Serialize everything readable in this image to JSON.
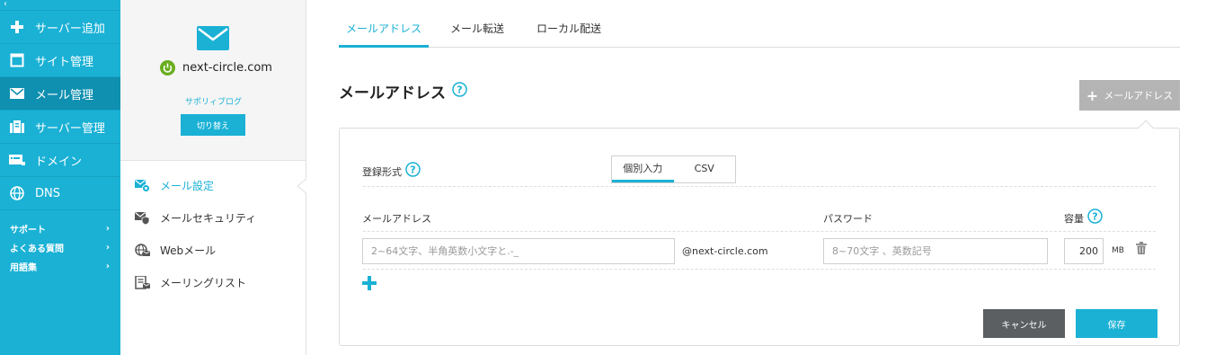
{
  "sidebar": {
    "collapse_glyph": "‹",
    "items": [
      {
        "label": "サーバー追加",
        "icon": "plus-icon"
      },
      {
        "label": "サイト管理",
        "icon": "window-icon"
      },
      {
        "label": "メール管理",
        "icon": "mail-icon"
      },
      {
        "label": "サーバー管理",
        "icon": "server-icon"
      },
      {
        "label": "ドメイン",
        "icon": "domain-icon"
      },
      {
        "label": "DNS",
        "icon": "globe-icon"
      }
    ],
    "support": [
      {
        "label": "サポート",
        "arrow": "›"
      },
      {
        "label": "よくある質問",
        "arrow": "›"
      },
      {
        "label": "用語集",
        "arrow": "›"
      }
    ]
  },
  "site": {
    "domain": "next-circle.com",
    "link": "サポリィブログ",
    "switch_label": "切り替え",
    "menu": [
      {
        "label": "メール設定",
        "icon": "mail-settings-icon"
      },
      {
        "label": "メールセキュリティ",
        "icon": "mail-security-icon"
      },
      {
        "label": "Webメール",
        "icon": "webmail-icon"
      },
      {
        "label": "メーリングリスト",
        "icon": "mailing-list-icon"
      }
    ]
  },
  "tabs": [
    "メールアドレス",
    "メール転送",
    "ローカル配送"
  ],
  "page": {
    "title": "メールアドレス",
    "add_button": "メールアドレス",
    "add_button_icon": "+"
  },
  "form": {
    "format_label": "登録形式",
    "format_options": [
      "個別入力",
      "CSV"
    ],
    "col_address": "メールアドレス",
    "col_password": "パスワード",
    "col_quota": "容量",
    "address_placeholder": "2~64文字、半角英数小文字と.-_",
    "domain_suffix": "@next-circle.com",
    "password_placeholder": "8~70文字 、英数記号",
    "quota_value": "200",
    "quota_unit": "MB",
    "cancel": "キャンセル",
    "save": "保存"
  },
  "colors": {
    "accent": "#1ab1d5",
    "sidebar_active": "#0f90b0",
    "power_green": "#6aad1e",
    "cancel_bg": "#5b5f62",
    "disabled_bg": "#b4b4b4"
  }
}
